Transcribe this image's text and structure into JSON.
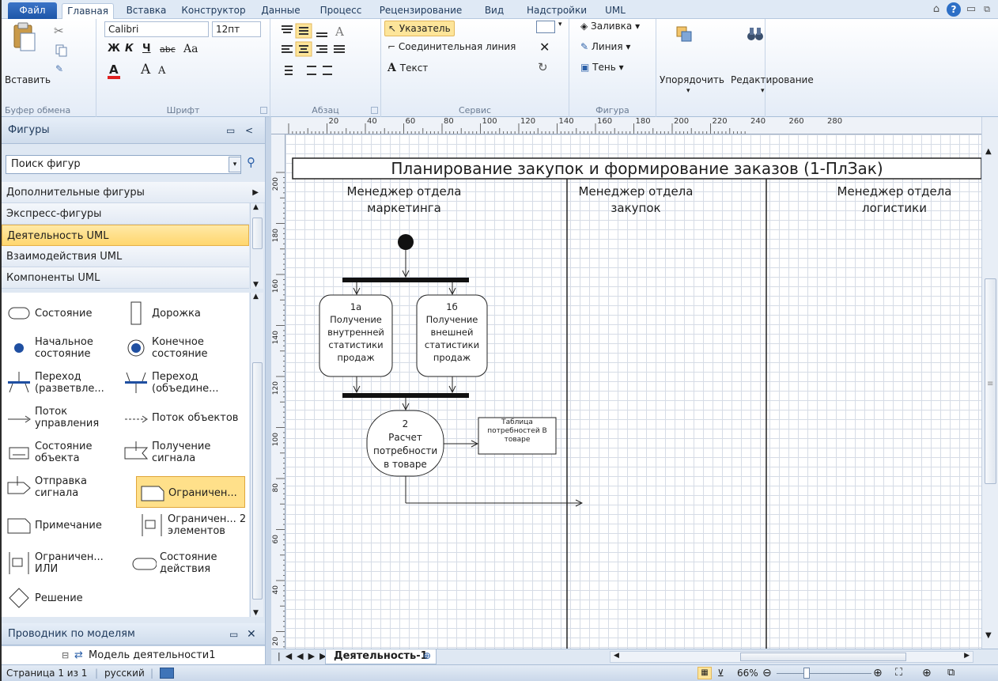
{
  "tabs": {
    "file": "Файл",
    "items": [
      "Главная",
      "Вставка",
      "Конструктор",
      "Данные",
      "Процесс",
      "Рецензирование",
      "Вид",
      "Надстройки",
      "UML"
    ]
  },
  "ribbon": {
    "clipboard": {
      "paste": "Вставить",
      "label": "Буфер обмена"
    },
    "font": {
      "name": "Calibri",
      "size": "12пт",
      "label": "Шрифт",
      "bold": "Ж",
      "italic": "К",
      "underline": "Ч",
      "strike": "abc",
      "case": "Aa",
      "grow": "A",
      "shrink": "A",
      "color": "A"
    },
    "paragraph": {
      "label": "Абзац"
    },
    "tools": {
      "pointer": "Указатель",
      "connector": "Соединительная линия",
      "text": "Текст",
      "label": "Сервис"
    },
    "shape": {
      "fill": "Заливка",
      "line": "Линия",
      "shadow": "Тень",
      "label": "Фигура"
    },
    "arrange": "Упорядочить",
    "editing": "Редактирование"
  },
  "panel": {
    "title": "Фигуры",
    "search_placeholder": "Поиск фигур",
    "stencils": [
      "Дополнительные фигуры",
      "Экспресс-фигуры",
      "Деятельность UML",
      "Взаимодействия UML",
      "Компоненты UML"
    ],
    "selected_stencil": "Деятельность UML",
    "shapes": [
      [
        "Состояние",
        "Дорожка"
      ],
      [
        "Начальное состояние",
        "Конечное состояние"
      ],
      [
        "Переход (разветвле...",
        "Переход (объедине..."
      ],
      [
        "Поток управления",
        "Поток объектов"
      ],
      [
        "Состояние объекта",
        "Получение сигнала"
      ],
      [
        "Отправка сигнала",
        "Ограничен..."
      ],
      [
        "Примечание",
        "Ограничен... 2 элементов"
      ],
      [
        "Ограничен... ИЛИ",
        "Состояние действия"
      ],
      [
        "Решение",
        ""
      ]
    ],
    "explorer_title": "Проводник по моделям",
    "explorer_item": "Модель деятельности1"
  },
  "ruler": {
    "top": [
      "20",
      "40",
      "60",
      "80",
      "100",
      "120",
      "140",
      "160",
      "180",
      "200",
      "220",
      "240",
      "260",
      "280"
    ],
    "left": [
      "200",
      "180",
      "160",
      "140",
      "120",
      "100",
      "80",
      "60",
      "40",
      "20"
    ]
  },
  "diagram": {
    "title": "Планирование закупок и формирование заказов (1-ПлЗак)",
    "lanes": [
      "Менеджер отдела маркетинга",
      "Менеджер отдела закупок",
      "Менеджер отдела логистики"
    ],
    "act1a": {
      "num": "1а",
      "text": "Получение внутренней статистики продаж"
    },
    "act1b": {
      "num": "1б",
      "text": "Получение внешней статистики продаж"
    },
    "act2": {
      "num": "2",
      "text": "Расчет потребности в товаре"
    },
    "object": "Таблица потребностей В товаре"
  },
  "pagetab": "Деятельность-1",
  "status": {
    "page": "Страница 1 из 1",
    "lang": "русский",
    "zoom": "66%"
  }
}
